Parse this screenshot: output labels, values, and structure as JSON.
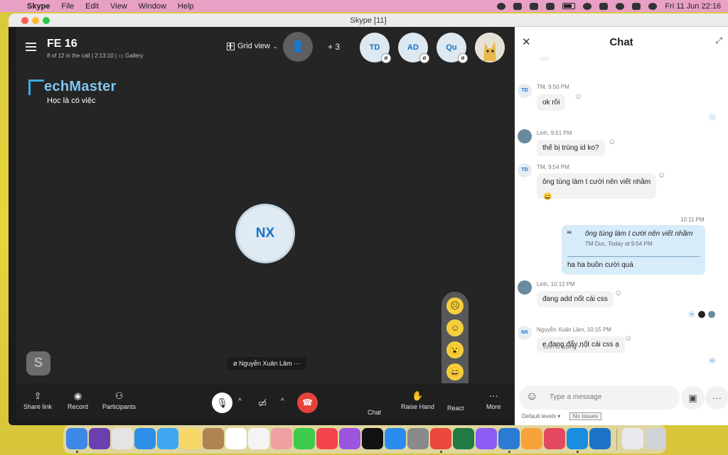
{
  "menubar": {
    "app": "Skype",
    "items": [
      "File",
      "Edit",
      "View",
      "Window",
      "Help"
    ],
    "datetime": "Fri 11 Jun  22:16"
  },
  "window": {
    "title": "Skype [11]"
  },
  "call": {
    "title": "FE 16",
    "subtitle": "8 of 12 in the call | 2:13:10 |",
    "gallery_label": "Gallery",
    "grid_view": "Grid view",
    "extra_count": "+ 3",
    "participants": [
      {
        "initials": "TD"
      },
      {
        "initials": "AD"
      },
      {
        "initials": "Qu"
      }
    ],
    "logo_text": "echMaster",
    "logo_sub": "Học là có việc",
    "main_speaker": "NX",
    "speaker_name": "Nguyễn Xuân Lâm",
    "speaker_menu": "···",
    "skype_letter": "S"
  },
  "controls": {
    "share_link": "Share link",
    "record": "Record",
    "participants": "Participants",
    "chat": "Chat",
    "raise_hand": "Raise Hand",
    "react": "React",
    "more": "More"
  },
  "reactions": [
    "☹",
    "☺",
    "😮",
    "😄",
    "👍"
  ],
  "chat": {
    "title": "Chat",
    "messages": [
      {
        "avatar": "TD",
        "meta": "TM, 9:50 PM",
        "text": "ok rồi"
      },
      {
        "avatar": "",
        "meta": "Linh, 9:51 PM",
        "text": "thế bị trùng id ko?"
      },
      {
        "avatar": "TD",
        "meta": "TM, 9:54 PM",
        "text": "ông tùng làm t cười nên viết nhầm"
      },
      {
        "avatar": "",
        "meta": "Linh, 10:12 PM",
        "text": "đang add nốt cái css"
      },
      {
        "avatar": "NX",
        "meta": "Nguyễn Xuân Lâm, 10:15 PM",
        "text": "e đang đẩy nốt cái css ạ"
      }
    ],
    "own_time": "10:11 PM",
    "quote_text": "ông tùng làm t cười nên viết nhầm",
    "quote_meta": "TM Duc, Today at 9:54 PM",
    "reply_text": "ha ha buồn cười quá",
    "typing": "Linh is typing",
    "placeholder": "Type a message",
    "read_tag": "TD",
    "nx_read": "NX"
  },
  "devtools": {
    "levels": "Default levels ▾",
    "issues": "No Issues"
  },
  "colors": {
    "accent": "#1473c9",
    "hangup": "#e8433a",
    "menubar": "#e9a0c5",
    "wallpaper": "#e6d53c"
  }
}
